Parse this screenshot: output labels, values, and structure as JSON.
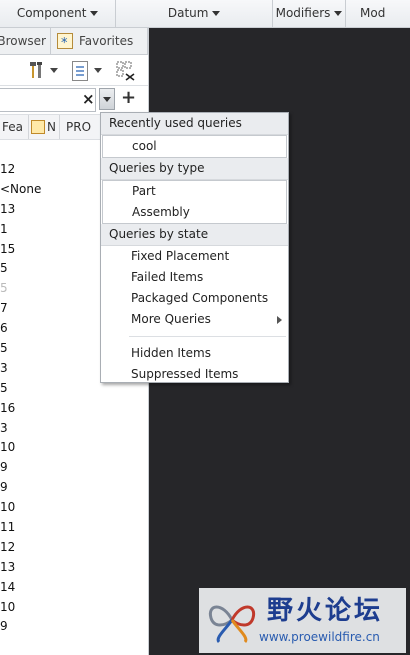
{
  "ribbon": {
    "groups": [
      {
        "label": "Component",
        "has_caret": true
      },
      {
        "label": "Datum",
        "has_caret": true
      },
      {
        "label": "Modifiers",
        "has_caret": true
      },
      {
        "label": "Mod",
        "has_caret": false
      }
    ]
  },
  "panel": {
    "tabs": {
      "folder_browser": "er Browser",
      "favorites": "Favorites"
    },
    "search": {
      "value": "",
      "clear_icon": "close-icon"
    },
    "columns": [
      "Fea",
      "N",
      "PRO"
    ],
    "values": [
      "12",
      "<None",
      "13",
      "1",
      "15",
      "5",
      "5",
      "7",
      "6",
      "5",
      "3",
      "5",
      "16",
      "3",
      "10",
      "9",
      "9",
      "10",
      "11",
      "12",
      "13",
      "14",
      "10",
      "9"
    ]
  },
  "popup": {
    "sections": {
      "recent": "Recently used queries",
      "by_type": "Queries by type",
      "by_state": "Queries by state"
    },
    "recent_items": [
      "cool"
    ],
    "type_items": [
      "Part",
      "Assembly"
    ],
    "state_items": [
      "Fixed Placement",
      "Failed Items",
      "Packaged Components",
      "More Queries"
    ],
    "extra_items": [
      "Hidden Items",
      "Suppressed Items"
    ]
  },
  "watermark": {
    "brand": "野火论坛",
    "url": "www.proewildfire.cn"
  },
  "colors": {
    "dark_area": "#262629",
    "accent": "#1d3d8f"
  }
}
